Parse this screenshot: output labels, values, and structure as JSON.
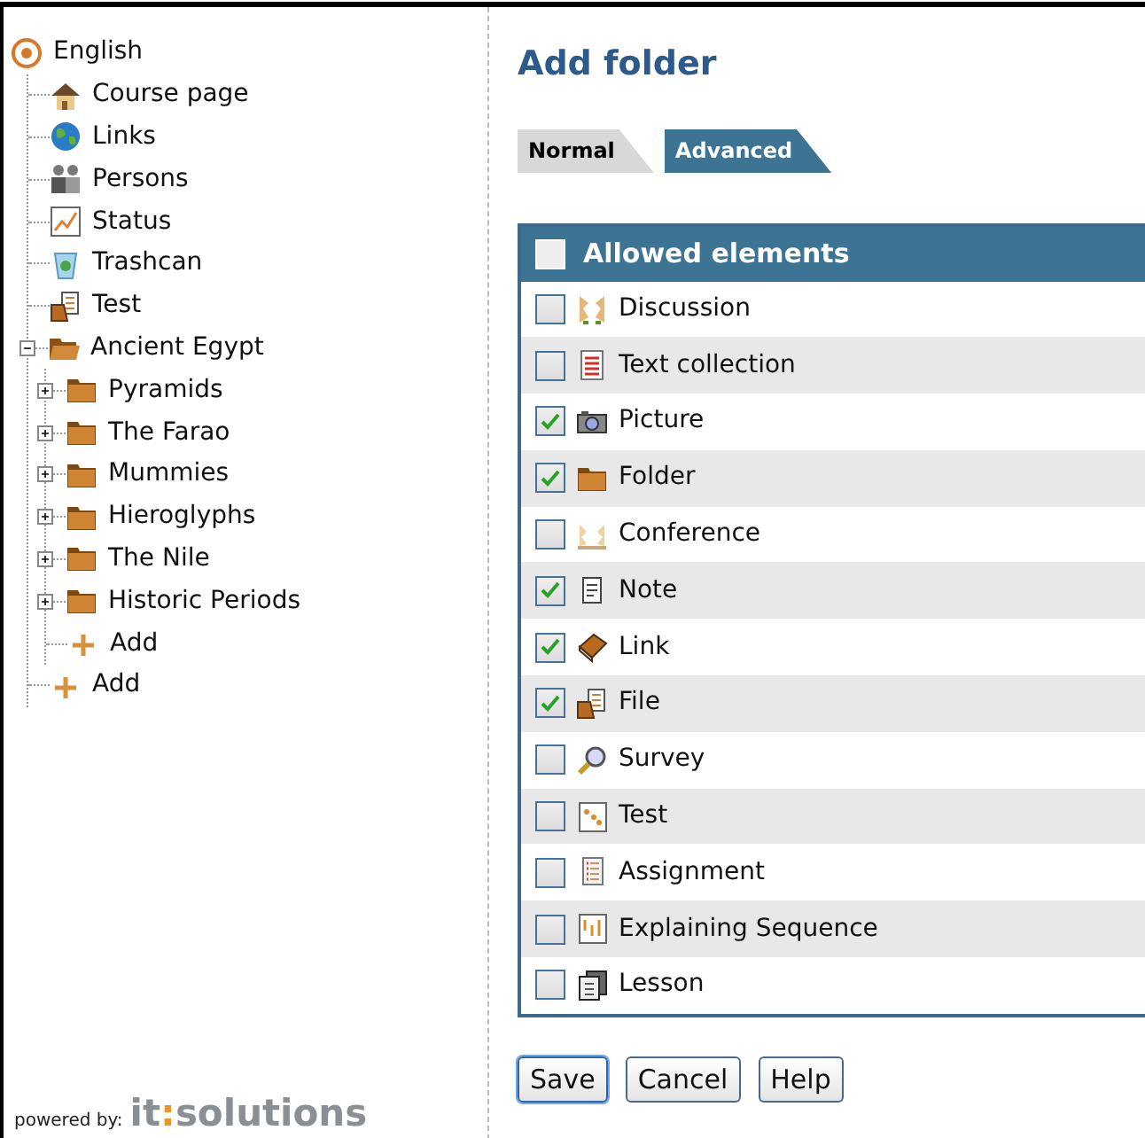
{
  "tree": {
    "label": "English",
    "kind": "target",
    "children": [
      {
        "label": "Course page",
        "kind": "house"
      },
      {
        "label": "Links",
        "kind": "globe"
      },
      {
        "label": "Persons",
        "kind": "persons"
      },
      {
        "label": "Status",
        "kind": "chart"
      },
      {
        "label": "Trashcan",
        "kind": "trash"
      },
      {
        "label": "Test",
        "kind": "file"
      },
      {
        "label": "Ancient Egypt",
        "kind": "openfolder",
        "expanded": true,
        "children": [
          {
            "label": "Pyramids",
            "kind": "folder",
            "expanded": false
          },
          {
            "label": "The Farao",
            "kind": "folder",
            "expanded": false
          },
          {
            "label": "Mummies",
            "kind": "folder",
            "expanded": false
          },
          {
            "label": "Hieroglyphs",
            "kind": "folder",
            "expanded": false
          },
          {
            "label": "The Nile",
            "kind": "folder",
            "expanded": false
          },
          {
            "label": "Historic Periods",
            "kind": "folder",
            "expanded": false
          },
          {
            "label": "Add",
            "kind": "plus"
          }
        ]
      },
      {
        "label": "Add",
        "kind": "plus"
      }
    ]
  },
  "footer": {
    "powered_by": "powered by:",
    "logo": [
      "it",
      ":",
      "solutions"
    ]
  },
  "title": "Add folder",
  "tabs": [
    {
      "label": "Normal",
      "selected": false
    },
    {
      "label": "Advanced",
      "selected": true
    }
  ],
  "table": {
    "header": {
      "label": "Allowed elements",
      "checked": false
    },
    "rows": [
      {
        "label": "Discussion",
        "kind": "discussion",
        "checked": false
      },
      {
        "label": "Text collection",
        "kind": "text",
        "checked": false
      },
      {
        "label": "Picture",
        "kind": "camera",
        "checked": true
      },
      {
        "label": "Folder",
        "kind": "folder",
        "checked": true
      },
      {
        "label": "Conference",
        "kind": "conference",
        "checked": false
      },
      {
        "label": "Note",
        "kind": "note",
        "checked": true
      },
      {
        "label": "Link",
        "kind": "book",
        "checked": true
      },
      {
        "label": "File",
        "kind": "file",
        "checked": true
      },
      {
        "label": "Survey",
        "kind": "magnifier",
        "checked": false
      },
      {
        "label": "Test",
        "kind": "test",
        "checked": false
      },
      {
        "label": "Assignment",
        "kind": "assignment",
        "checked": false
      },
      {
        "label": "Explaining Sequence",
        "kind": "sequence",
        "checked": false
      },
      {
        "label": "Lesson",
        "kind": "lesson",
        "checked": false
      }
    ]
  },
  "buttons": [
    {
      "label": "Save",
      "default": true
    },
    {
      "label": "Cancel",
      "default": false
    },
    {
      "label": "Help",
      "default": false
    }
  ]
}
